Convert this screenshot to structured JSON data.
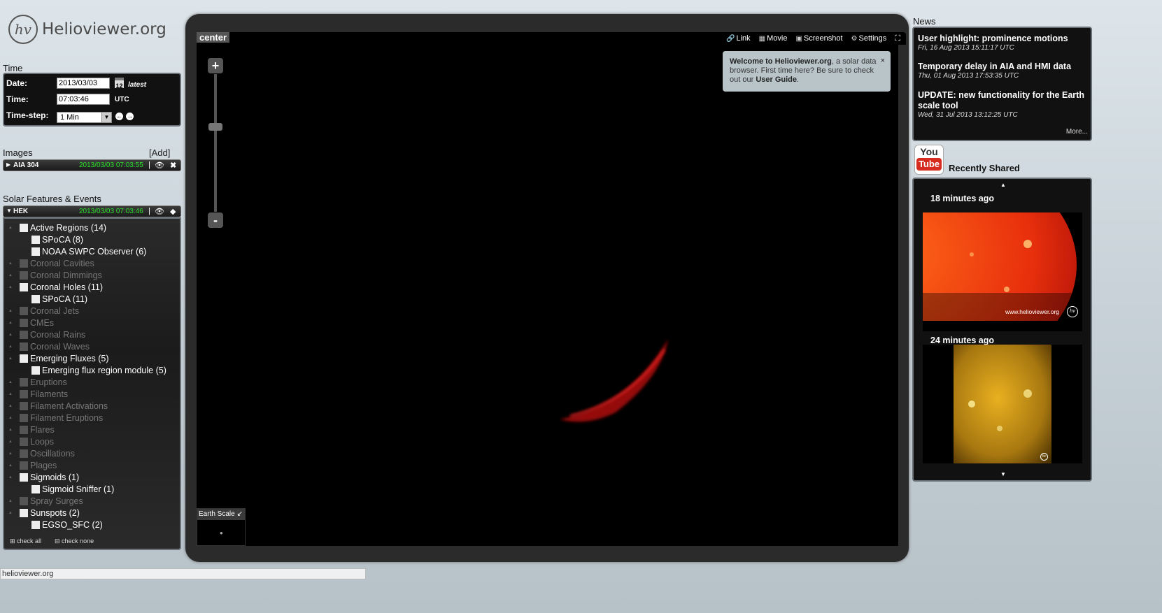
{
  "logo": {
    "badge": "hv",
    "name": "Helioviewer.org"
  },
  "time": {
    "title": "Time",
    "date_label": "Date:",
    "date_value": "2013/03/03",
    "calendar_day": "12",
    "latest": "latest",
    "time_label": "Time:",
    "time_value": "07:03:46",
    "utc": "UTC",
    "step_label": "Time-step:",
    "step_value": "1 Min"
  },
  "images": {
    "title": "Images",
    "add": "[Add]",
    "layer": {
      "name": "AIA 304",
      "date": "2013/03/03 07:03:55",
      "sep": "|"
    }
  },
  "features": {
    "title": "Solar Features & Events",
    "hek": {
      "name": "HEK",
      "date": "2013/03/03 07:03:46",
      "sep": "|"
    },
    "check_all": "check all",
    "check_none": "check none",
    "items": [
      {
        "label": "Active Regions (14)",
        "level": 0,
        "active": true
      },
      {
        "label": "SPoCA (8)",
        "level": 1,
        "active": true
      },
      {
        "label": "NOAA SWPC Observer (6)",
        "level": 1,
        "active": true
      },
      {
        "label": "Coronal Cavities",
        "level": 0,
        "active": false
      },
      {
        "label": "Coronal Dimmings",
        "level": 0,
        "active": false
      },
      {
        "label": "Coronal Holes (11)",
        "level": 0,
        "active": true
      },
      {
        "label": "SPoCA (11)",
        "level": 1,
        "active": true
      },
      {
        "label": "Coronal Jets",
        "level": 0,
        "active": false
      },
      {
        "label": "CMEs",
        "level": 0,
        "active": false
      },
      {
        "label": "Coronal Rains",
        "level": 0,
        "active": false
      },
      {
        "label": "Coronal Waves",
        "level": 0,
        "active": false
      },
      {
        "label": "Emerging Fluxes (5)",
        "level": 0,
        "active": true
      },
      {
        "label": "Emerging flux region module (5)",
        "level": 1,
        "active": true
      },
      {
        "label": "Eruptions",
        "level": 0,
        "active": false
      },
      {
        "label": "Filaments",
        "level": 0,
        "active": false
      },
      {
        "label": "Filament Activations",
        "level": 0,
        "active": false
      },
      {
        "label": "Filament Eruptions",
        "level": 0,
        "active": false
      },
      {
        "label": "Flares",
        "level": 0,
        "active": false
      },
      {
        "label": "Loops",
        "level": 0,
        "active": false
      },
      {
        "label": "Oscillations",
        "level": 0,
        "active": false
      },
      {
        "label": "Plages",
        "level": 0,
        "active": false
      },
      {
        "label": "Sigmoids (1)",
        "level": 0,
        "active": true
      },
      {
        "label": "Sigmoid Sniffer (1)",
        "level": 1,
        "active": true
      },
      {
        "label": "Spray Surges",
        "level": 0,
        "active": false
      },
      {
        "label": "Sunspots (2)",
        "level": 0,
        "active": true
      },
      {
        "label": "EGSO_SFC (2)",
        "level": 1,
        "active": true
      }
    ]
  },
  "viewport": {
    "center_label": "center",
    "menu": {
      "link": "Link",
      "movie": "Movie",
      "screenshot": "Screenshot",
      "settings": "Settings"
    },
    "zoom_in": "+",
    "zoom_out": "-",
    "welcome": {
      "strong": "Welcome to Helioviewer.org",
      "text": ", a solar data browser. First time here? Be sure to check out our ",
      "guide": "User Guide",
      "end": ".",
      "close": "×"
    },
    "earth_scale": "Earth Scale"
  },
  "news": {
    "title": "News",
    "items": [
      {
        "title": "User highlight: prominence motions",
        "date": "Fri, 16 Aug 2013 15:11:17 UTC"
      },
      {
        "title": "Temporary delay in AIA and HMI data",
        "date": "Thu, 01 Aug 2013 17:53:35 UTC"
      },
      {
        "title": "UPDATE: new functionality for the Earth scale tool",
        "date": "Wed, 31 Jul 2013 13:12:25 UTC"
      }
    ],
    "more": "More..."
  },
  "shared": {
    "youtube_you": "You",
    "youtube_tube": "Tube",
    "title": "Recently Shared",
    "items": [
      {
        "time": "18 minutes ago",
        "watermark": "www.helioviewer.org"
      },
      {
        "time": "24 minutes ago"
      }
    ]
  },
  "status_bar": "helioviewer.org",
  "colors": {
    "accent_green": "#2de02d",
    "panel_bg": "#111111",
    "youtube_red": "#d62b1f"
  }
}
